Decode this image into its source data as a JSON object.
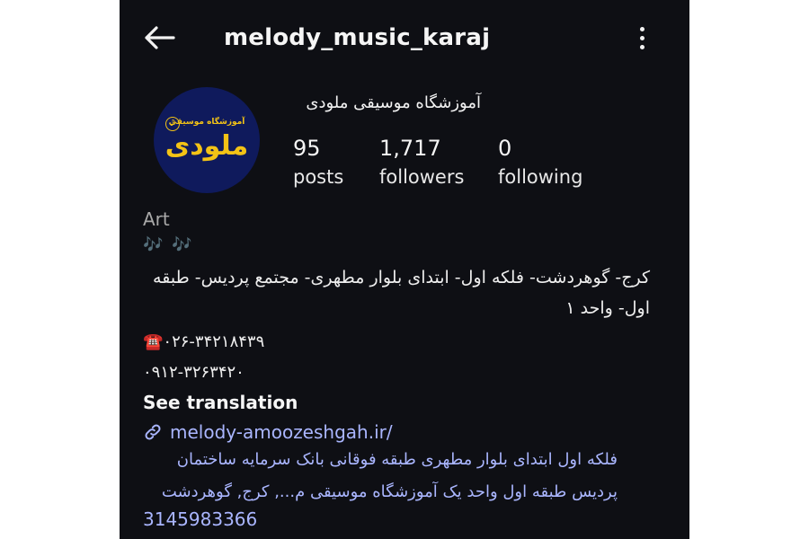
{
  "header": {
    "username": "melody_music_karaj",
    "back_icon": "arrow-left-icon",
    "more_icon": "more-vertical-icon"
  },
  "profile": {
    "avatar": {
      "top_text": "آموزشگاه موسیقی",
      "main_text": "ملودی",
      "note_symbol": "♪",
      "bg_color": "#0f1a5c",
      "text_color": "#f3c316"
    },
    "display_name": "آموزشگاه موسیقی ملودی",
    "stats": {
      "posts_count": "95",
      "posts_label": "posts",
      "followers_count": "1,717",
      "followers_label": "followers",
      "following_count": "0",
      "following_label": "following"
    }
  },
  "bio": {
    "category": "Art",
    "emoji_line": "🎶 🎶",
    "address_line": "کرج- گوهردشت- فلکه اول- ابتدای بلوار مطهری- مجتمع پردیس- طبقه اول- واحد ۱",
    "phone_icon": "☎️",
    "phone_1": "۰۲۶-۳۴۲۱۸۴۳۹",
    "phone_2": "۰۹۱۲-۳۲۶۳۴۲۰",
    "see_translation": "See translation"
  },
  "link": {
    "icon": "link-icon",
    "text": "melody-amoozeshgah.ir/"
  },
  "address_block": {
    "text": "فلکه اول ابتدای بلوار مطهری طبقه فوقانی بانک سرمایه ساختمان پردیس طبقه اول واحد یک آموزشگاه موسیقی م..., کرج, گوهردشت",
    "phone": "3145983366"
  },
  "colors": {
    "background": "#0e0f14",
    "link": "#aab6ff",
    "muted": "#a9a9a9"
  }
}
